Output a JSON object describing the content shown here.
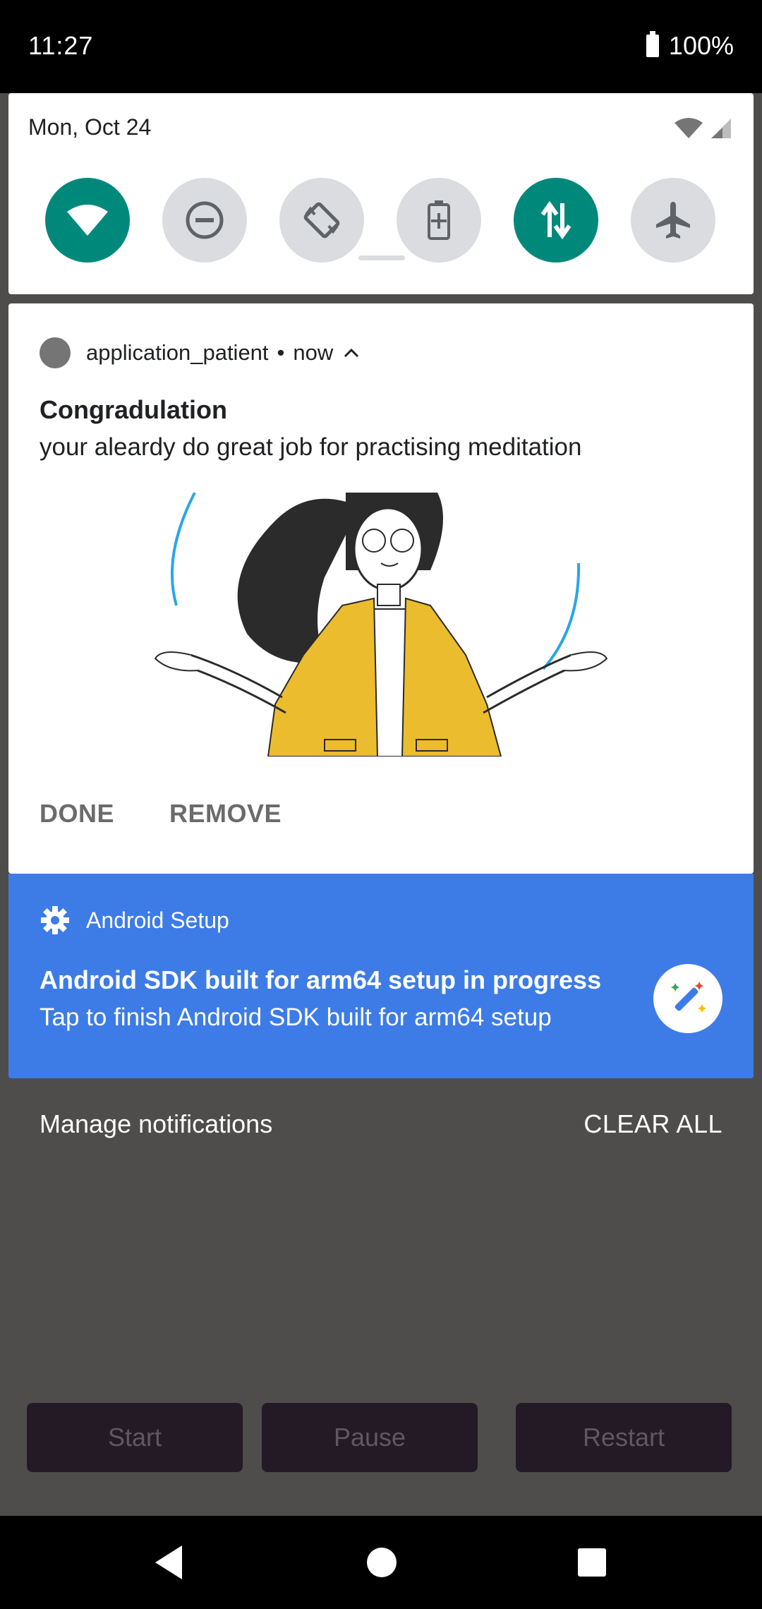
{
  "status_bar": {
    "time": "11:27",
    "battery": "100%"
  },
  "quick_settings": {
    "date": "Mon, Oct 24",
    "tiles": [
      {
        "name": "wifi",
        "state": "on"
      },
      {
        "name": "do-not-disturb",
        "state": "off"
      },
      {
        "name": "auto-rotate",
        "state": "off"
      },
      {
        "name": "battery-saver",
        "state": "off"
      },
      {
        "name": "mobile-data",
        "state": "on"
      },
      {
        "name": "airplane-mode",
        "state": "off"
      }
    ],
    "active_color": "#00897b",
    "inactive_color": "#dadce0"
  },
  "notification1": {
    "app_name": "application_patient",
    "separator": "•",
    "time": "now",
    "title": "Congradulation",
    "text": "your aleardy do great job for practising meditation",
    "actions": [
      "DONE",
      "REMOVE"
    ],
    "image_icon": "meditating-woman-illustration"
  },
  "notification2": {
    "app_name": "Android Setup",
    "title": "Android SDK built for arm64 setup in progress",
    "text": "Tap to finish Android SDK built for arm64 setup",
    "background": "#3d7ce6"
  },
  "footer": {
    "manage": "Manage notifications",
    "clear_all": "CLEAR ALL"
  },
  "app_buttons": [
    "Start",
    "Pause",
    "Restart"
  ]
}
